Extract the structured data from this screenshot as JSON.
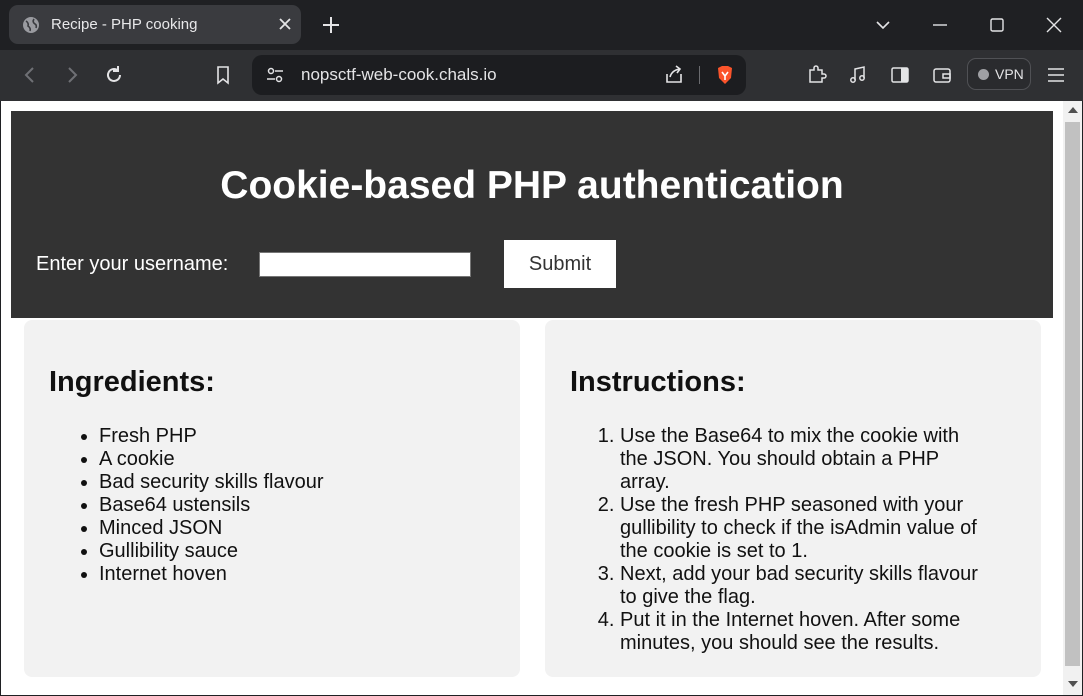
{
  "browser": {
    "tab_title": "Recipe - PHP cooking",
    "url": "nopsctf-web-cook.chals.io",
    "vpn_label": "VPN"
  },
  "page": {
    "title": "Cookie-based PHP authentication",
    "username_label": "Enter your username:",
    "username_value": "",
    "submit_label": "Submit",
    "ingredients": {
      "heading": "Ingredients:",
      "items": [
        "Fresh PHP",
        "A cookie",
        "Bad security skills flavour",
        "Base64 ustensils",
        "Minced JSON",
        "Gullibility sauce",
        "Internet hoven"
      ]
    },
    "instructions": {
      "heading": "Instructions:",
      "steps": [
        "Use the Base64 to mix the cookie with the JSON. You should obtain a PHP array.",
        "Use the fresh PHP seasoned with your gullibility to check if the isAdmin value of the cookie is set to 1.",
        "Next, add your bad security skills flavour to give the flag.",
        "Put it in the Internet hoven. After some minutes, you should see the results."
      ]
    }
  },
  "colors": {
    "header_bg": "#333333",
    "card_bg": "#f2f2f2",
    "chrome_bg": "#1f2023",
    "brave_orange": "#fb542b"
  }
}
